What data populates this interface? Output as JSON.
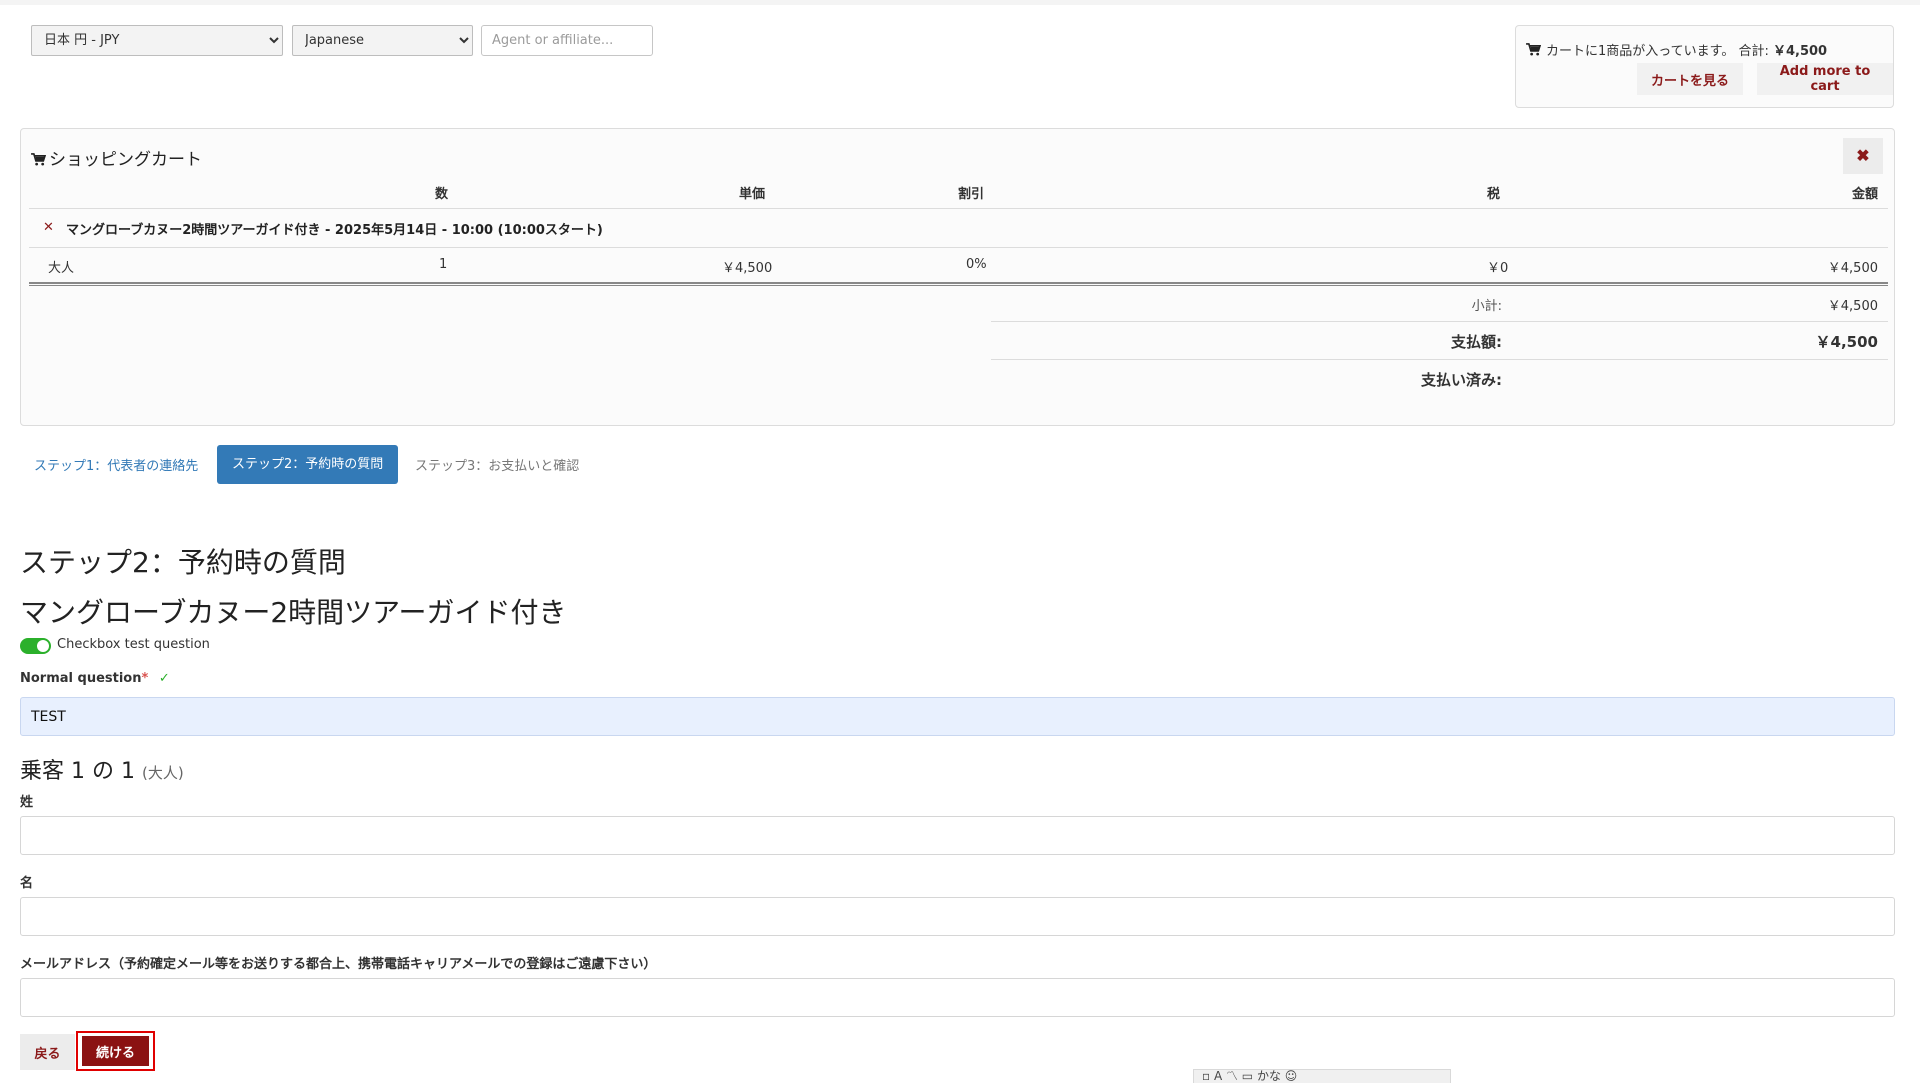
{
  "currency": {
    "selected": "日本 円 - JPY",
    "options": [
      "日本 円 - JPY"
    ]
  },
  "language": {
    "selected": "Japanese",
    "options": [
      "Japanese"
    ]
  },
  "affiliate": {
    "placeholder": "Agent or affiliate..."
  },
  "cart_summary": {
    "text": "カートに1商品が入っています。 合計:",
    "total": "￥4,500",
    "view_cart_label": "カートを見る",
    "add_more_label": "Add more to cart"
  },
  "cart": {
    "title": "ショッピングカート",
    "headers": {
      "qty": "数",
      "unit_price": "単価",
      "discount": "割引",
      "tax": "税",
      "amount": "金額"
    },
    "item_title": "マングローブカヌー2時間ツアーガイド付き - 2025年5月14日 - 10:00 (10:00スタート)",
    "rows": [
      {
        "type": "大人",
        "qty": "1",
        "unit_price": "￥4,500",
        "discount": "0%",
        "tax": "￥0",
        "amount": "￥4,500"
      }
    ],
    "subtotal_label": "小計:",
    "subtotal_value": "￥4,500",
    "payment_label": "支払額:",
    "payment_value": "￥4,500",
    "paid_label": "支払い済み:"
  },
  "steps": {
    "step1": "ステップ1：代表者の連絡先",
    "step2": "ステップ2：予約時の質問",
    "step3": "ステップ3：お支払いと確認"
  },
  "form": {
    "step_heading": "ステップ2：予約時の質問",
    "tour_heading": "マングローブカヌー2時間ツアーガイド付き",
    "checkbox_label": "Checkbox test question",
    "normal_question_label": "Normal question",
    "required_mark": "*",
    "check_mark": "✓",
    "normal_question_value": "TEST",
    "passenger_heading": "乗客 1 の 1",
    "passenger_type": "(大人)",
    "last_name_label": "姓",
    "first_name_label": "名",
    "email_label": "メールアドレス（予約確定メール等をお送りする都合上、携帯電話キャリアメールでの登録はご遠慮下さい）"
  },
  "buttons": {
    "back": "戻る",
    "continue": "続ける"
  },
  "ime": {
    "text": "▫ A 〽 ▭ かな ☺"
  },
  "colors": {
    "accent": "#337ab7",
    "danger": "#8b1a1a",
    "toggle": "#2bb02b",
    "highlight": "#e00000"
  }
}
